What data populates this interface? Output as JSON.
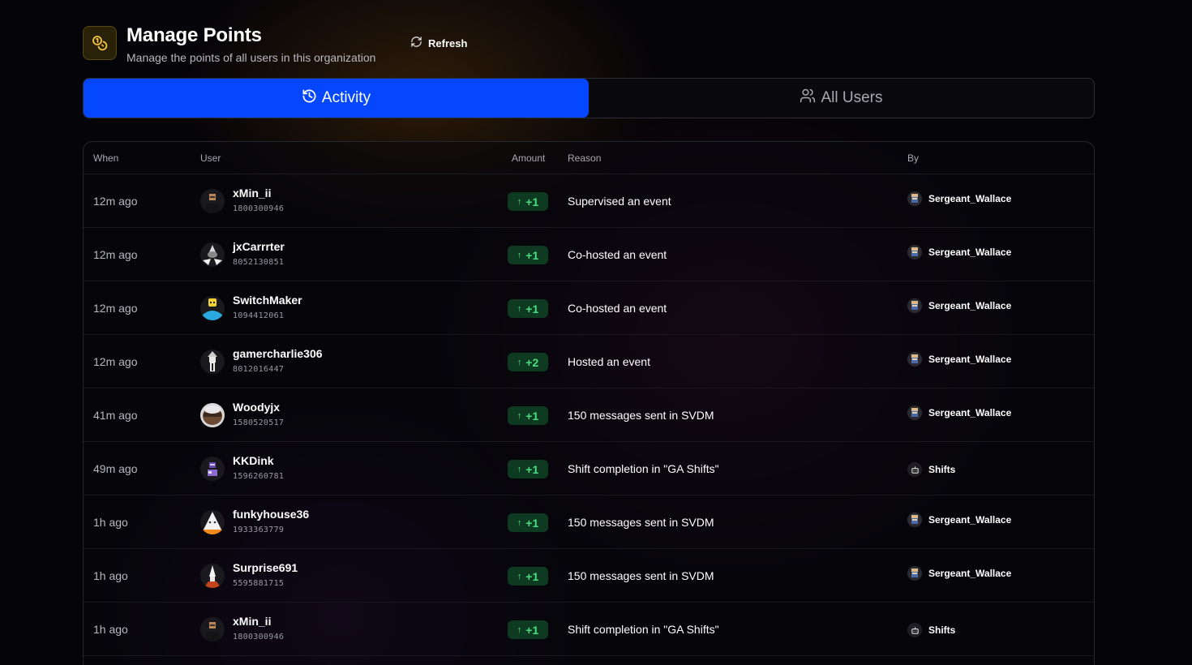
{
  "header": {
    "title": "Manage Points",
    "subtitle": "Manage the points of all users in this organization",
    "icon": "coins-icon",
    "refresh_label": "Refresh"
  },
  "tabs": [
    {
      "label": "Activity",
      "icon": "history-icon",
      "active": true
    },
    {
      "label": "All Users",
      "icon": "users-icon",
      "active": false
    }
  ],
  "colors": {
    "accent": "#0546ff",
    "positive": "#4ade80",
    "badge_bg": "#0e3a22"
  },
  "table": {
    "columns": {
      "when": "When",
      "user": "User",
      "amount": "Amount",
      "reason": "Reason",
      "by": "By"
    },
    "rows": [
      {
        "when": "12m ago",
        "user": "xMin_ii",
        "user_id": "1800300946",
        "amount": "+1",
        "reason": "Supervised an event",
        "by": "Sergeant_Wallace",
        "by_type": "user"
      },
      {
        "when": "12m ago",
        "user": "jxCarrrter",
        "user_id": "8052130851",
        "amount": "+1",
        "reason": "Co-hosted an event",
        "by": "Sergeant_Wallace",
        "by_type": "user"
      },
      {
        "when": "12m ago",
        "user": "SwitchMaker",
        "user_id": "1094412061",
        "amount": "+1",
        "reason": "Co-hosted an event",
        "by": "Sergeant_Wallace",
        "by_type": "user"
      },
      {
        "when": "12m ago",
        "user": "gamercharlie306",
        "user_id": "8012016447",
        "amount": "+2",
        "reason": "Hosted an event",
        "by": "Sergeant_Wallace",
        "by_type": "user"
      },
      {
        "when": "41m ago",
        "user": "Woodyjx",
        "user_id": "1580520517",
        "amount": "+1",
        "reason": "150 messages sent in SVDM",
        "by": "Sergeant_Wallace",
        "by_type": "user"
      },
      {
        "when": "49m ago",
        "user": "KKDink",
        "user_id": "1596260781",
        "amount": "+1",
        "reason": "Shift completion in \"GA Shifts\"",
        "by": "Shifts",
        "by_type": "bot"
      },
      {
        "when": "1h ago",
        "user": "funkyhouse36",
        "user_id": "1933363779",
        "amount": "+1",
        "reason": "150 messages sent in SVDM",
        "by": "Sergeant_Wallace",
        "by_type": "user"
      },
      {
        "when": "1h ago",
        "user": "Surprise691",
        "user_id": "5595881715",
        "amount": "+1",
        "reason": "150 messages sent in SVDM",
        "by": "Sergeant_Wallace",
        "by_type": "user"
      },
      {
        "when": "1h ago",
        "user": "xMin_ii",
        "user_id": "1800300946",
        "amount": "+1",
        "reason": "Shift completion in \"GA Shifts\"",
        "by": "Shifts",
        "by_type": "bot"
      }
    ]
  }
}
